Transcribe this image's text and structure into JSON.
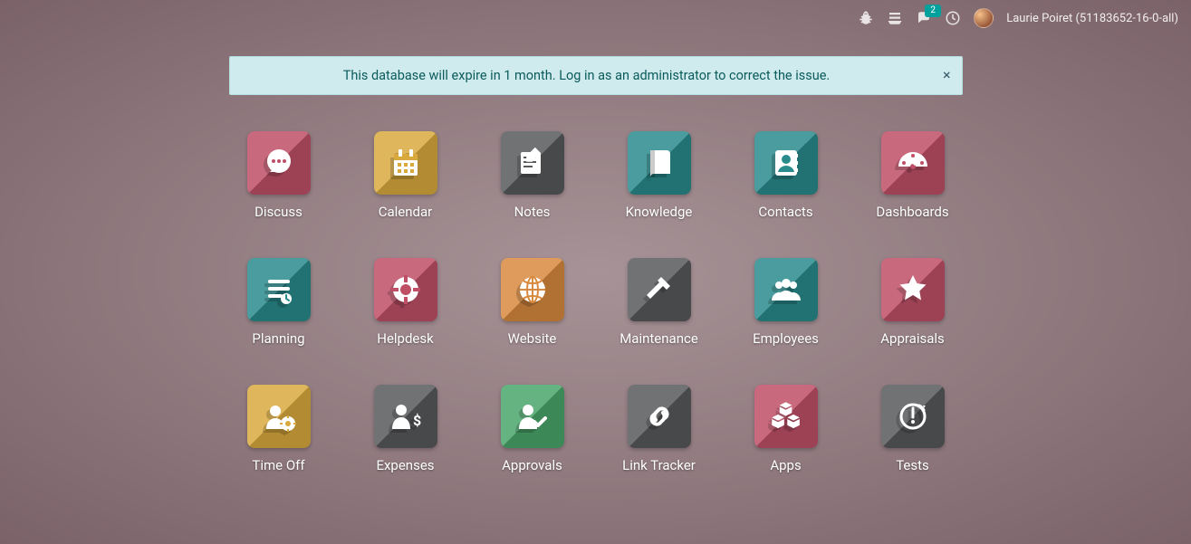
{
  "topbar": {
    "messages_badge": "2",
    "user_name": "Laurie Poiret (51183652-16-0-all)"
  },
  "alert": {
    "text": "This database will expire in 1 month. Log in as an administrator to correct the issue.",
    "close": "×"
  },
  "apps": [
    {
      "id": "discuss",
      "label": "Discuss",
      "color": "c-pink",
      "icon": "chat"
    },
    {
      "id": "calendar",
      "label": "Calendar",
      "color": "c-yellow",
      "icon": "calendar"
    },
    {
      "id": "notes",
      "label": "Notes",
      "color": "c-gray",
      "icon": "notes"
    },
    {
      "id": "knowledge",
      "label": "Knowledge",
      "color": "c-teal",
      "icon": "book"
    },
    {
      "id": "contacts",
      "label": "Contacts",
      "color": "c-teal",
      "icon": "contact"
    },
    {
      "id": "dashboards",
      "label": "Dashboards",
      "color": "c-pink",
      "icon": "gauge"
    },
    {
      "id": "planning",
      "label": "Planning",
      "color": "c-teal",
      "icon": "planning"
    },
    {
      "id": "helpdesk",
      "label": "Helpdesk",
      "color": "c-pink",
      "icon": "lifebuoy"
    },
    {
      "id": "website",
      "label": "Website",
      "color": "c-orange",
      "icon": "globe"
    },
    {
      "id": "maintenance",
      "label": "Maintenance",
      "color": "c-gray",
      "icon": "hammer"
    },
    {
      "id": "employees",
      "label": "Employees",
      "color": "c-teal",
      "icon": "people"
    },
    {
      "id": "appraisals",
      "label": "Appraisals",
      "color": "c-pink",
      "icon": "star"
    },
    {
      "id": "timeoff",
      "label": "Time Off",
      "color": "c-yellow",
      "icon": "timeoff"
    },
    {
      "id": "expenses",
      "label": "Expenses",
      "color": "c-gray",
      "icon": "expense"
    },
    {
      "id": "approvals",
      "label": "Approvals",
      "color": "c-green",
      "icon": "approve"
    },
    {
      "id": "linktracker",
      "label": "Link Tracker",
      "color": "c-gray",
      "icon": "link"
    },
    {
      "id": "apps",
      "label": "Apps",
      "color": "c-pink",
      "icon": "cubes"
    },
    {
      "id": "tests",
      "label": "Tests",
      "color": "c-gray",
      "icon": "tests"
    }
  ]
}
